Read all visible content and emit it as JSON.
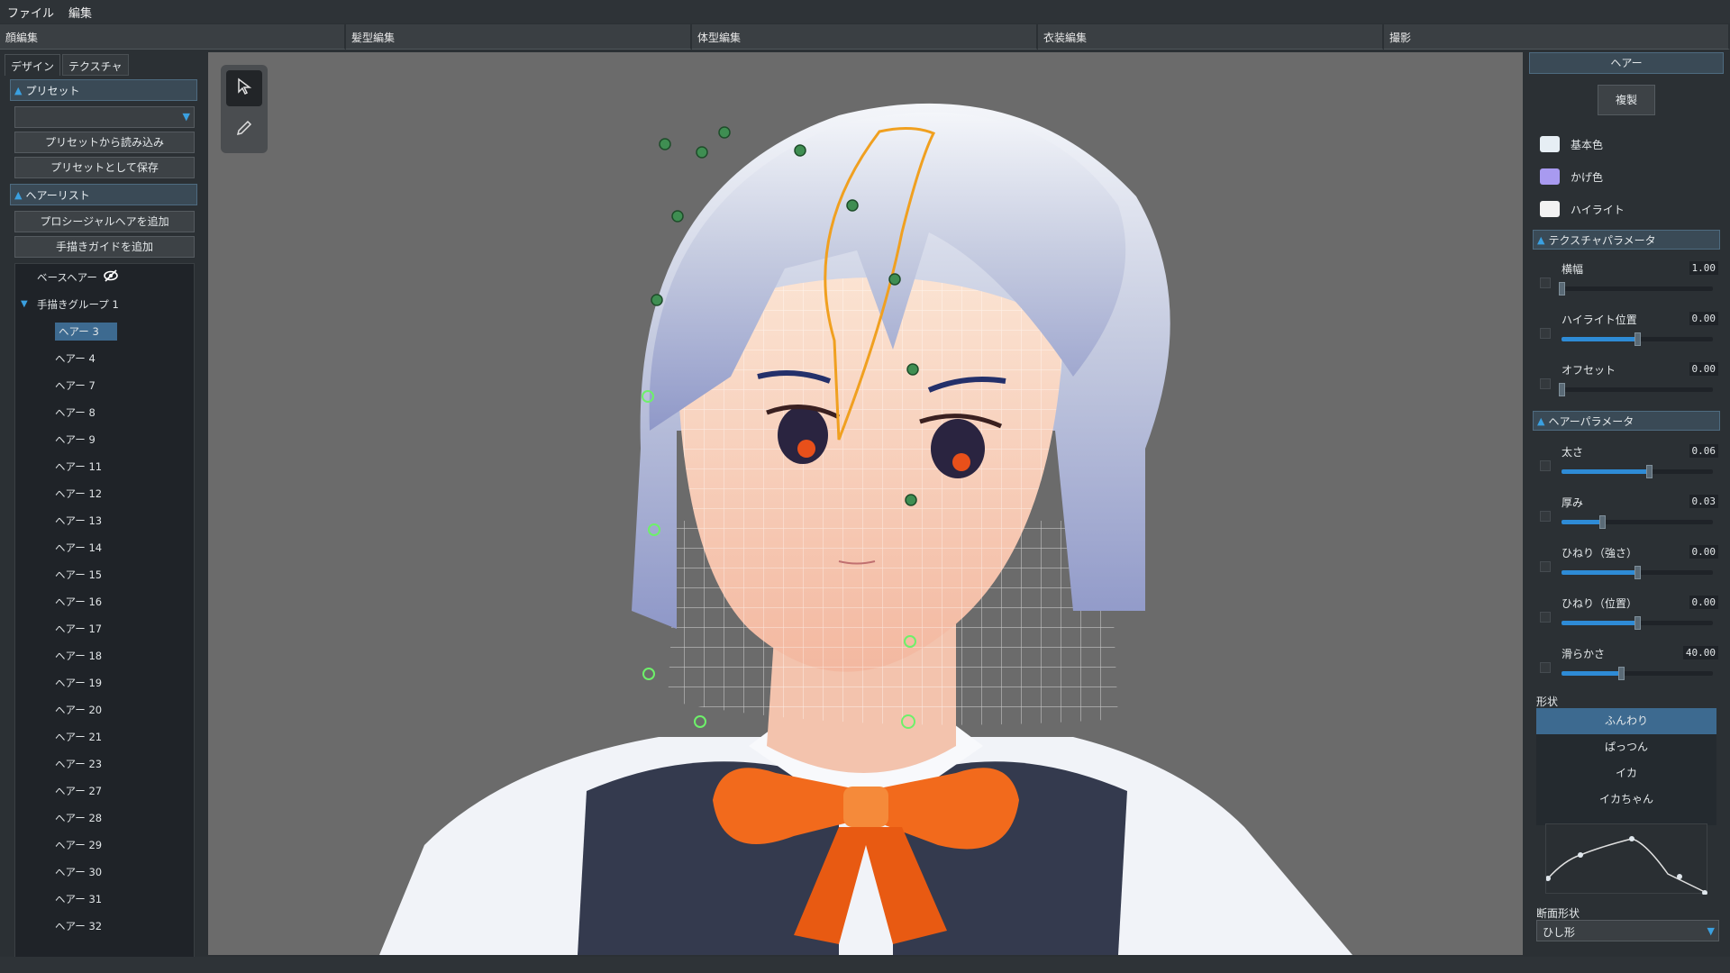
{
  "menu": [
    "ファイル",
    "編集"
  ],
  "tabs": [
    "顔編集",
    "髪型編集",
    "体型編集",
    "衣装編集",
    "撮影"
  ],
  "left_panel": {
    "subtabs": [
      "デザイン",
      "テクスチャ"
    ],
    "preset_section": "プリセット",
    "preset_dropdown_value": "",
    "load_preset": "プリセットから読み込み",
    "save_preset": "プリセットとして保存",
    "hairlist_section": "ヘアーリスト",
    "add_procedural": "プロシージャルヘアを追加",
    "add_guide": "手描きガイドを追加",
    "base_hair": "ベースヘアー",
    "group": "手描きグループ 1",
    "hairs": [
      "ヘアー 3",
      "ヘアー 4",
      "ヘアー 7",
      "ヘアー 8",
      "ヘアー 9",
      "ヘアー 11",
      "ヘアー 12",
      "ヘアー 13",
      "ヘアー 14",
      "ヘアー 15",
      "ヘアー 16",
      "ヘアー 17",
      "ヘアー 18",
      "ヘアー 19",
      "ヘアー 20",
      "ヘアー 21",
      "ヘアー 23",
      "ヘアー 27",
      "ヘアー 28",
      "ヘアー 29",
      "ヘアー 30",
      "ヘアー 31",
      "ヘアー 32"
    ],
    "selected_hair": "ヘアー 3"
  },
  "right_panel": {
    "title": "ヘアー",
    "duplicate": "複製",
    "colors": [
      {
        "label": "基本色",
        "color": "#e6eef4"
      },
      {
        "label": "かげ色",
        "color": "#a89af0"
      },
      {
        "label": "ハイライト",
        "color": "#f2f2f2"
      }
    ],
    "texture_section": "テクスチャパラメータ",
    "texture_params": [
      {
        "label": "横幅",
        "value": "1.00",
        "fraction": 0.0
      },
      {
        "label": "ハイライト位置",
        "value": "0.00",
        "fraction": 0.5
      },
      {
        "label": "オフセット",
        "value": "0.00",
        "fraction": 0.0
      }
    ],
    "hair_section": "ヘアーパラメータ",
    "hair_params": [
      {
        "label": "太さ",
        "value": "0.06",
        "fraction": 0.58
      },
      {
        "label": "厚み",
        "value": "0.03",
        "fraction": 0.27
      },
      {
        "label": "ひねり（強さ）",
        "value": "0.00",
        "fraction": 0.5
      },
      {
        "label": "ひねり（位置）",
        "value": "0.00",
        "fraction": 0.5
      },
      {
        "label": "滑らかさ",
        "value": "40.00",
        "fraction": 0.39
      }
    ],
    "shape_label": "形状",
    "shapes": [
      "ふんわり",
      "ぱっつん",
      "イカ",
      "イカちゃん"
    ],
    "selected_shape": "ふんわり",
    "cross_label": "断面形状",
    "cross_value": "ひし形"
  },
  "icons": {
    "select_tool": "cursor-arrow-icon",
    "draw_tool": "pencil-icon",
    "visibility": "eye-off-icon"
  }
}
